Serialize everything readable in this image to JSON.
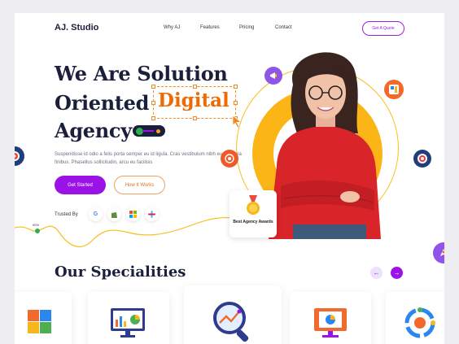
{
  "nav": {
    "logo": "AJ. Studio",
    "items": [
      "Why AJ",
      "Features",
      "Pricing",
      "Contact"
    ],
    "cta": "Get A Quote"
  },
  "hero": {
    "line1": "We Are Solution",
    "line2_prefix": "Oriented",
    "line2_highlight": "Digital",
    "line3": "Agency",
    "description": "Suspendisse id odio a felis porta semper eu id ligula. Cras vestibulum nibh eu vehicula finibus. Phasellus sollicitudin, arcu eu facilisis",
    "primary_button": "Get Started",
    "secondary_button": "How It Works",
    "trusted_label": "Trusted By",
    "trusted_brands": [
      "G",
      "s",
      "ms",
      "sl"
    ],
    "growth_label": "90%"
  },
  "award": {
    "label": "Best Agency Awards"
  },
  "specialities": {
    "title": "Our Specialities"
  },
  "colors": {
    "purple": "#9b12e6",
    "orange": "#f06a00",
    "yellow": "#fbb516",
    "navy": "#1b1f3b"
  }
}
